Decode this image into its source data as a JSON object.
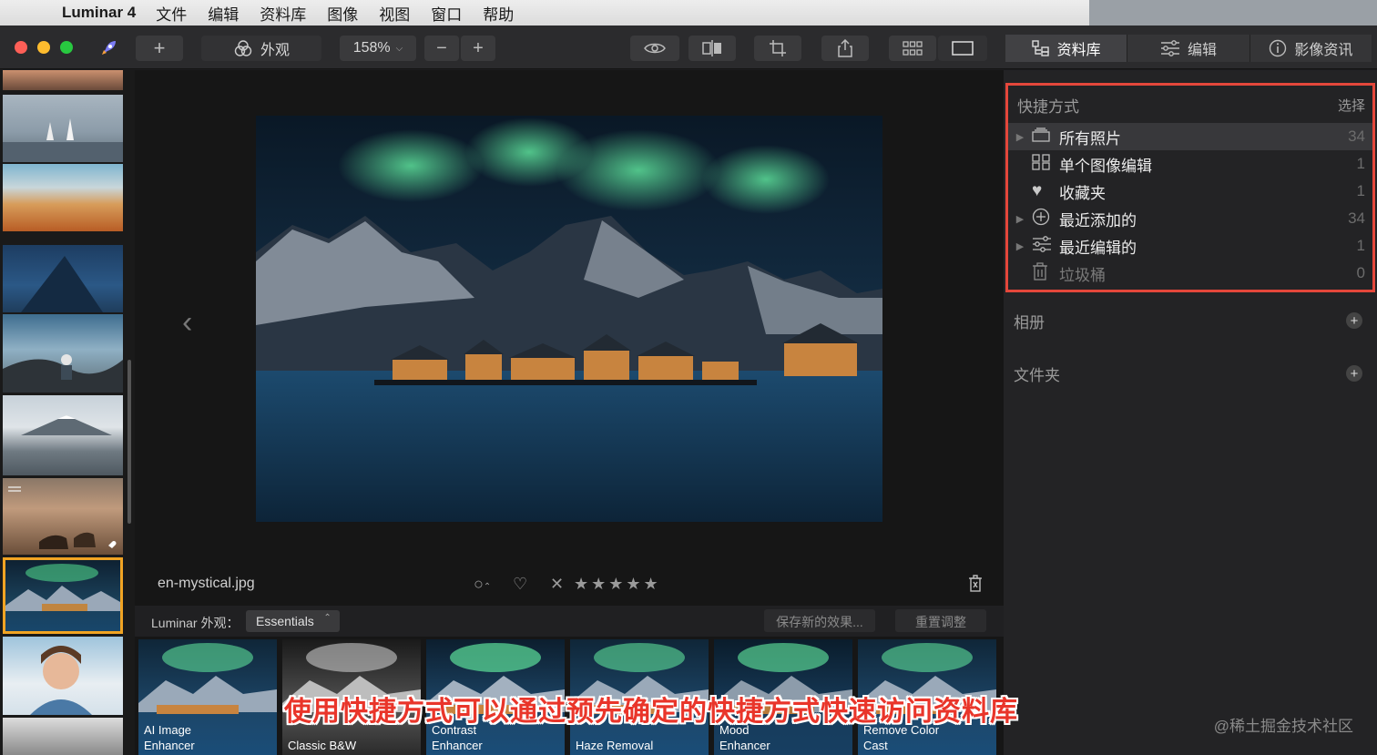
{
  "menubar": {
    "app_name": "Luminar 4",
    "items": [
      "文件",
      "编辑",
      "资料库",
      "图像",
      "视图",
      "窗口",
      "帮助"
    ]
  },
  "toolbar": {
    "looks_label": "外观",
    "zoom_label": "158%",
    "tabs": [
      {
        "label": "资料库",
        "icon": "library-icon",
        "active": true
      },
      {
        "label": "编辑",
        "icon": "sliders-icon",
        "active": false
      },
      {
        "label": "影像资讯",
        "icon": "info-icon",
        "active": false
      }
    ]
  },
  "main": {
    "filename": "en-mystical.jpg",
    "looks_prefix": "Luminar 外观：",
    "looks_collection": "Essentials",
    "save_look_label": "保存新的效果...",
    "reset_label": "重置调整"
  },
  "looks": [
    {
      "line1": "AI Image",
      "line2": "Enhancer"
    },
    {
      "line1": "",
      "line2": "Classic B&W"
    },
    {
      "line1": "Contrast",
      "line2": "Enhancer"
    },
    {
      "line1": "",
      "line2": "Haze Removal"
    },
    {
      "line1": "Mood",
      "line2": "Enhancer"
    },
    {
      "line1": "Remove Color",
      "line2": "Cast"
    }
  ],
  "shortcuts": {
    "title": "快捷方式",
    "select_label": "选择",
    "items": [
      {
        "label": "所有照片",
        "count": "34",
        "icon": "photos-stack-icon",
        "expandable": true,
        "highlighted": true
      },
      {
        "label": "单个图像编辑",
        "count": "1",
        "icon": "grid-icon",
        "expandable": false,
        "highlighted": false
      },
      {
        "label": "收藏夹",
        "count": "1",
        "icon": "heart-icon",
        "expandable": false,
        "highlighted": false
      },
      {
        "label": "最近添加的",
        "count": "34",
        "icon": "plus-circle-icon",
        "expandable": true,
        "highlighted": false
      },
      {
        "label": "最近编辑的",
        "count": "1",
        "icon": "sliders-icon",
        "expandable": true,
        "highlighted": false
      },
      {
        "label": "垃圾桶",
        "count": "0",
        "icon": "trash-icon",
        "expandable": false,
        "highlighted": false
      }
    ]
  },
  "sections": {
    "albums": "相册",
    "folders": "文件夹"
  },
  "caption": "使用快捷方式可以通过预先确定的快捷方式快速访问资料库",
  "watermark": "@稀土掘金技术社区",
  "colors": {
    "accent_border": "#e4473b",
    "selected_thumb": "#f1a423",
    "caption": "#e9352a"
  }
}
